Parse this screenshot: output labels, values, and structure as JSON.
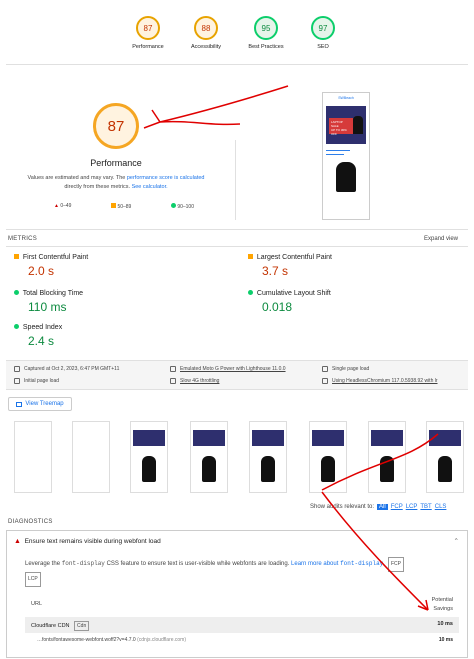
{
  "categories": [
    {
      "score": "87",
      "label": "Performance",
      "color": "#e8a300"
    },
    {
      "score": "88",
      "label": "Accessibility",
      "color": "#e8a300"
    },
    {
      "score": "95",
      "label": "Best Practices",
      "color": "#0c8a3f"
    },
    {
      "score": "97",
      "label": "SEO",
      "color": "#0c8a3f"
    }
  ],
  "main": {
    "score": "87",
    "title": "Performance",
    "desc_1": "Values are estimated and may vary. The",
    "desc_link1": "performance score is calculated",
    "desc_2": "directly from these metrics.",
    "desc_link2": "See calculator.",
    "legend": [
      {
        "range": "0–49",
        "color": "#cc0000"
      },
      {
        "range": "50–89",
        "color": "#ffa400"
      },
      {
        "range": "90–100",
        "color": "#0cce6b"
      }
    ]
  },
  "preview": {
    "site_name": "SWBeach",
    "banner_text": "LAPTOP SALE",
    "banner_sub": "UP TO 30% OFF",
    "btn": "SHOP NOW"
  },
  "metrics": {
    "header": "METRICS",
    "expand": "Expand view",
    "items": [
      {
        "label": "First Contentful Paint",
        "value": "2.0 s",
        "status": "orange"
      },
      {
        "label": "Largest Contentful Paint",
        "value": "3.7 s",
        "status": "orange"
      },
      {
        "label": "Total Blocking Time",
        "value": "110 ms",
        "status": "green"
      },
      {
        "label": "Cumulative Layout Shift",
        "value": "0.018",
        "status": "green"
      },
      {
        "label": "Speed Index",
        "value": "2.4 s",
        "status": "green"
      }
    ]
  },
  "env": {
    "captured": "Captured at Oct 2, 2023, 6:47 PM GMT+11",
    "emulated": "Emulated Moto G Power with Lighthouse 11.0.0",
    "single": "Single page load",
    "initial": "Initial page load",
    "throttling": "Slow 4G throttling",
    "browser": "Using HeadlessChromium 117.0.5938.92 with lr"
  },
  "treemap": {
    "label": "View Treemap"
  },
  "audits": {
    "show_label": "Show audits relevant to:",
    "filters": [
      "All",
      "FCP",
      "LCP",
      "TBT",
      "CLS"
    ]
  },
  "diagnostics": {
    "header": "DIAGNOSTICS",
    "title": "Ensure text remains visible during webfont load",
    "desc_1": "Leverage the",
    "code_1": "font-display",
    "desc_2": "CSS feature to ensure text is user-visible while webfonts are loading.",
    "desc_link": "Learn more about",
    "code_2": "font-display",
    "chips": [
      "FCP",
      "LCP"
    ],
    "col_url": "URL",
    "col_savings_1": "Potential",
    "col_savings_2": "Savings",
    "rows": [
      {
        "name": "Cloudflare CDN",
        "tag": "Cdn",
        "savings": "10 ms",
        "host": ""
      },
      {
        "name": "…fonts/fontawesome-webfont.woff2?v=4.7.0",
        "tag": "",
        "savings": "10 ms",
        "host": "(cdnjs.cloudflare.com)"
      }
    ]
  }
}
